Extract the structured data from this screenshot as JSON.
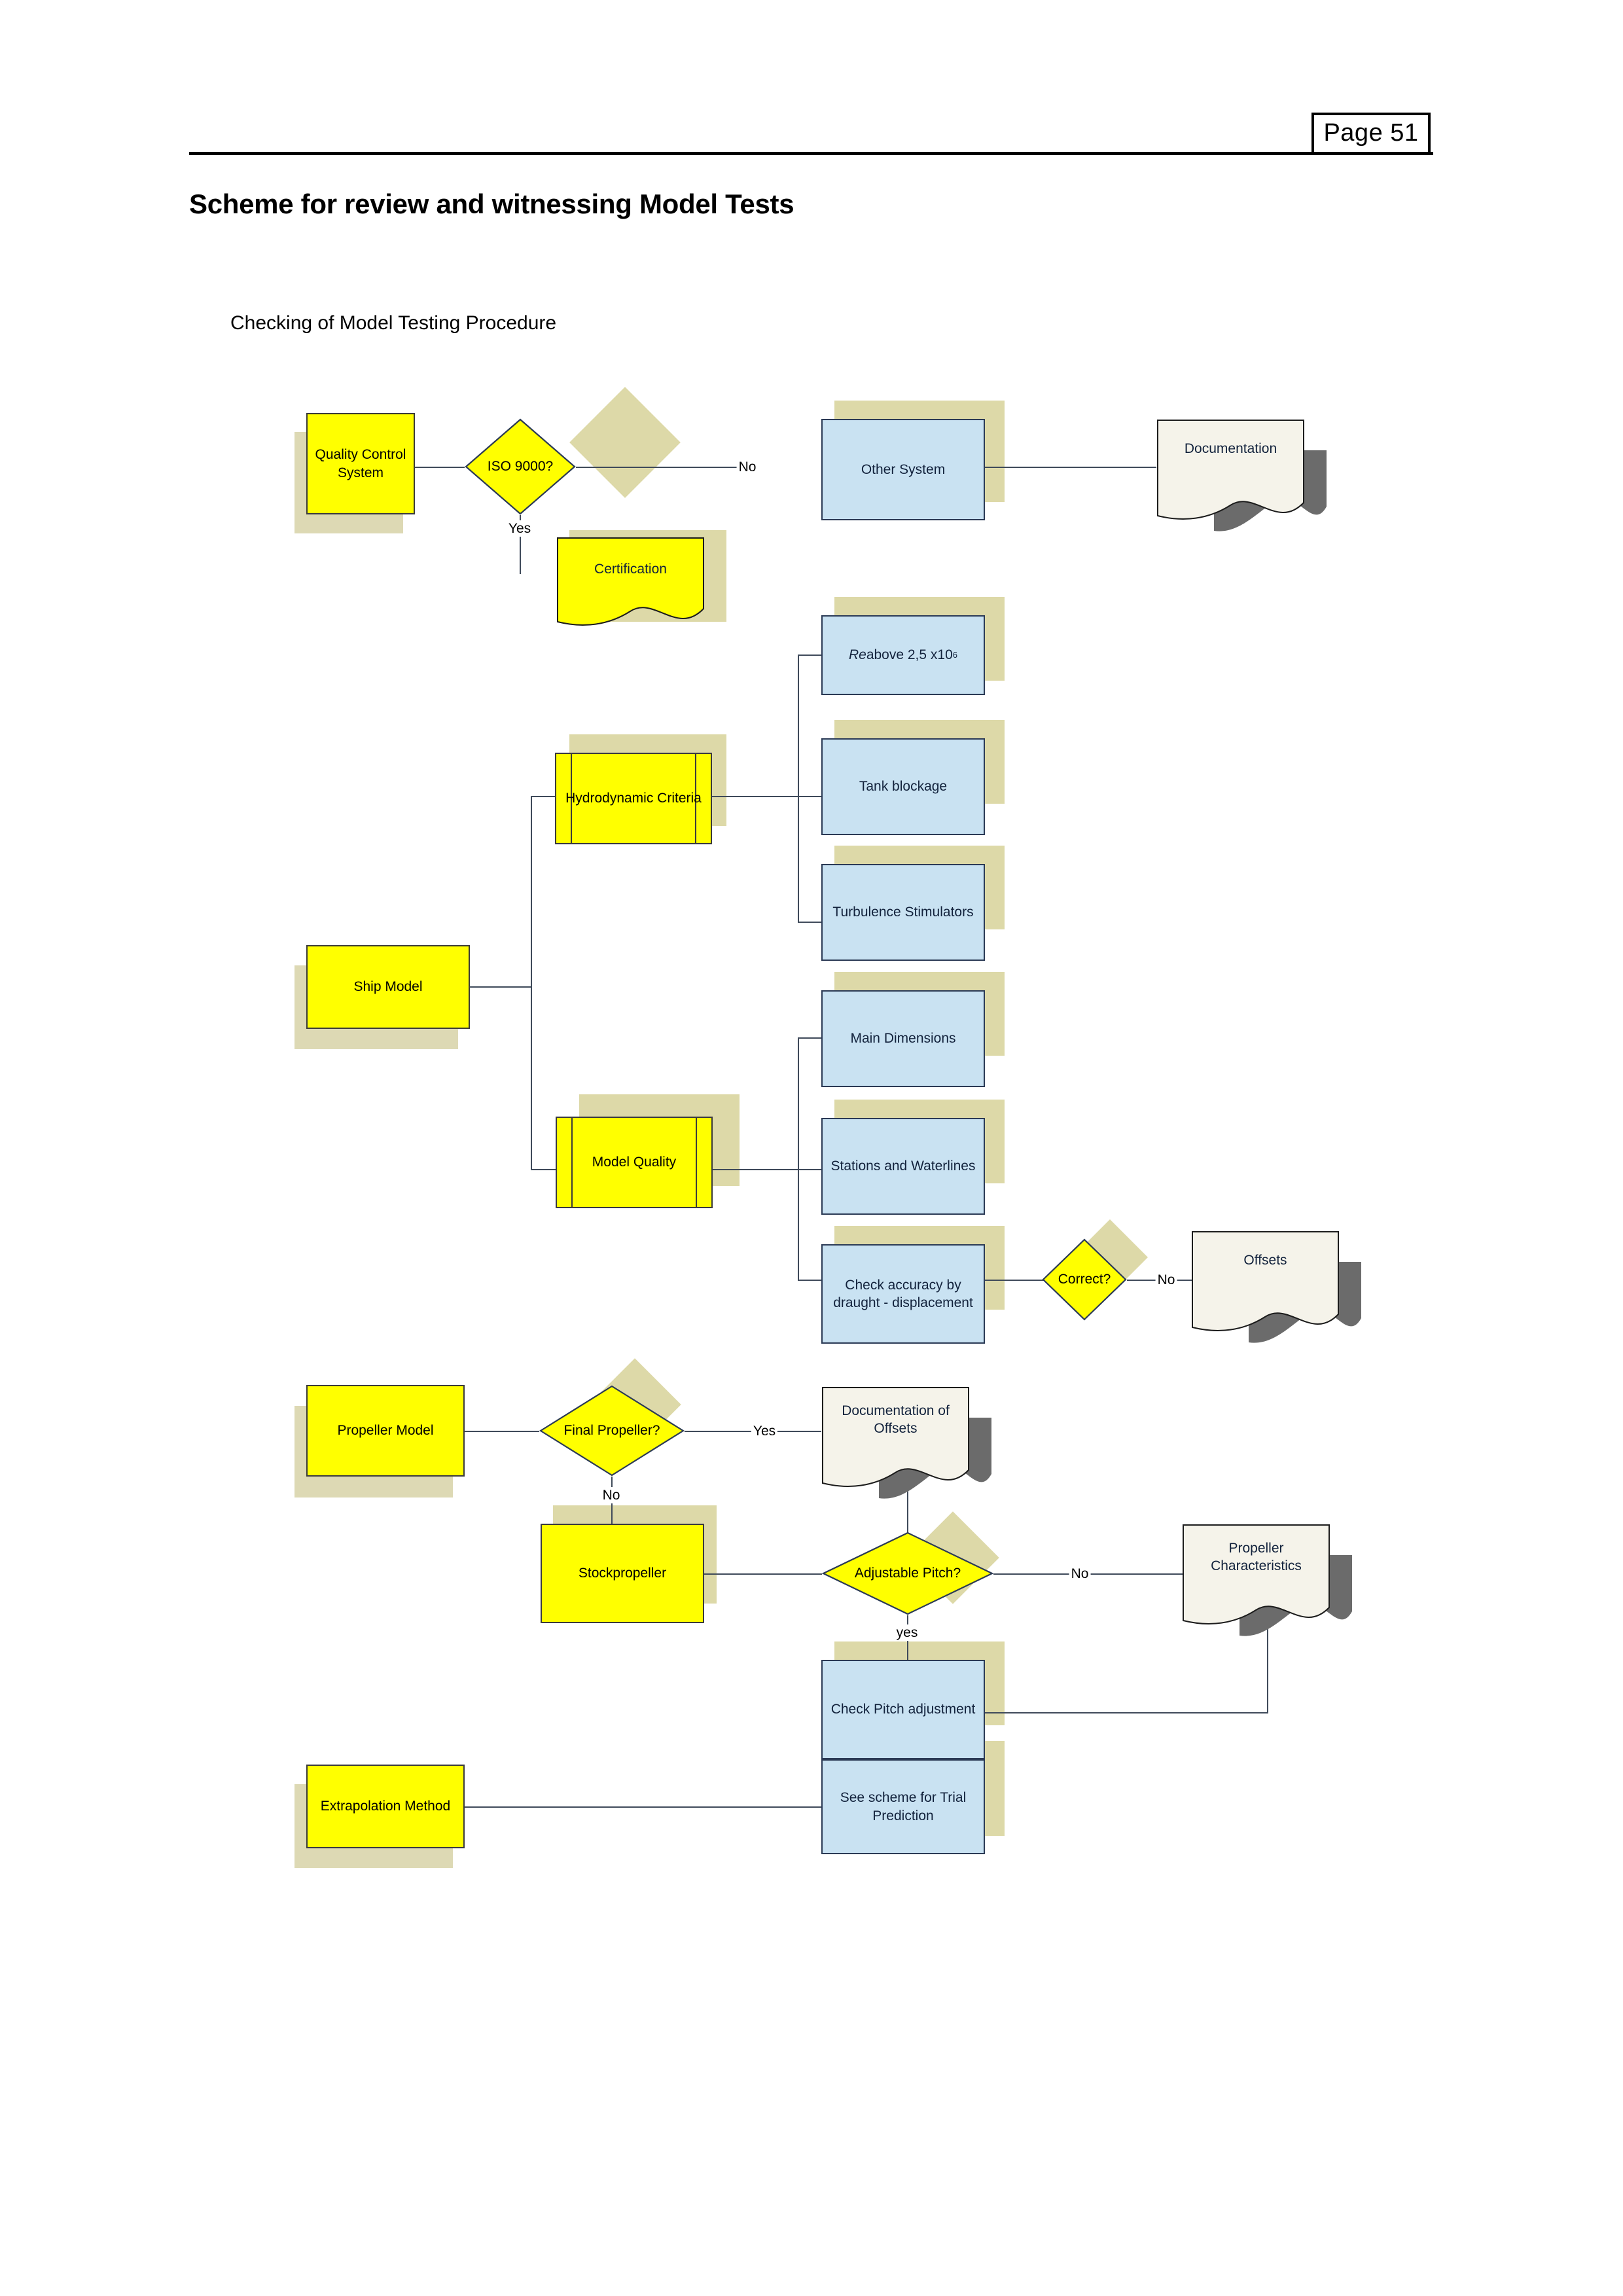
{
  "header": {
    "page_badge": "Page 51",
    "title": "Scheme for review and witnessing Model Tests",
    "subtitle": "Checking of Model Testing Procedure"
  },
  "colors": {
    "yellow_fill": "#ffff00",
    "blue_fill": "#c9e2f2",
    "doc_fill": "#f5f3ea",
    "shadow_tan": "#ddd9a8",
    "shadow_gray": "#6b6b6b",
    "line": "#3f4a5a",
    "text": "#12223c"
  },
  "nodes": {
    "quality_control_system": {
      "label": "Quality Control System",
      "shape": "process",
      "fill": "yellow"
    },
    "iso_9000": {
      "label": "ISO 9000?",
      "shape": "decision",
      "fill": "yellow"
    },
    "other_system": {
      "label": "Other System",
      "shape": "process",
      "fill": "blue"
    },
    "documentation": {
      "label": "Documentation",
      "shape": "document",
      "fill": "white"
    },
    "certification": {
      "label": "Certification",
      "shape": "document",
      "fill": "yellow"
    },
    "ship_model": {
      "label": "Ship Model",
      "shape": "process",
      "fill": "yellow"
    },
    "hydrodynamic_criteria": {
      "label": "Hydrodynamic Criteria",
      "shape": "predefined-process",
      "fill": "yellow"
    },
    "model_quality": {
      "label": "Model Quality",
      "shape": "predefined-process",
      "fill": "yellow"
    },
    "re_above": {
      "label_prefix": "Re",
      "label_rest": " above 2,5 x10",
      "label_sup": "6",
      "shape": "process",
      "fill": "blue"
    },
    "tank_blockage": {
      "label": "Tank blockage",
      "shape": "process",
      "fill": "blue"
    },
    "turbulence_stimulators": {
      "label": "Turbulence Stimulators",
      "shape": "process",
      "fill": "blue"
    },
    "main_dimensions": {
      "label": "Main Dimensions",
      "shape": "process",
      "fill": "blue"
    },
    "stations_and_waterlines": {
      "label": "Stations and Waterlines",
      "shape": "process",
      "fill": "blue"
    },
    "check_accuracy": {
      "label": "Check accuracy by draught - displacement",
      "shape": "process",
      "fill": "blue"
    },
    "correct": {
      "label": "Correct?",
      "shape": "decision",
      "fill": "yellow"
    },
    "offsets": {
      "label": "Offsets",
      "shape": "document",
      "fill": "white"
    },
    "propeller_model": {
      "label": "Propeller Model",
      "shape": "process",
      "fill": "yellow"
    },
    "final_propeller": {
      "label": "Final Propeller?",
      "shape": "decision",
      "fill": "yellow"
    },
    "documentation_of_offsets": {
      "label": "Documentation of Offsets",
      "shape": "document",
      "fill": "white"
    },
    "stockpropeller": {
      "label": "Stockpropeller",
      "shape": "process",
      "fill": "yellow"
    },
    "adjustable_pitch": {
      "label": "Adjustable Pitch?",
      "shape": "decision",
      "fill": "yellow"
    },
    "propeller_characteristics": {
      "label": "Propeller Characteristics",
      "shape": "document",
      "fill": "white"
    },
    "check_pitch_adjustment": {
      "label": "Check Pitch adjustment",
      "shape": "process",
      "fill": "blue"
    },
    "extrapolation_method": {
      "label": "Extrapolation Method",
      "shape": "process",
      "fill": "yellow"
    },
    "see_scheme_trial_prediction": {
      "label": "See scheme for Trial Prediction",
      "shape": "process",
      "fill": "blue"
    }
  },
  "edge_labels": {
    "iso_no": "No",
    "iso_yes": "Yes",
    "correct_no": "No",
    "final_propeller_yes": "Yes",
    "final_propeller_no": "No",
    "adjustable_pitch_no": "No",
    "adjustable_pitch_yes": "yes"
  }
}
